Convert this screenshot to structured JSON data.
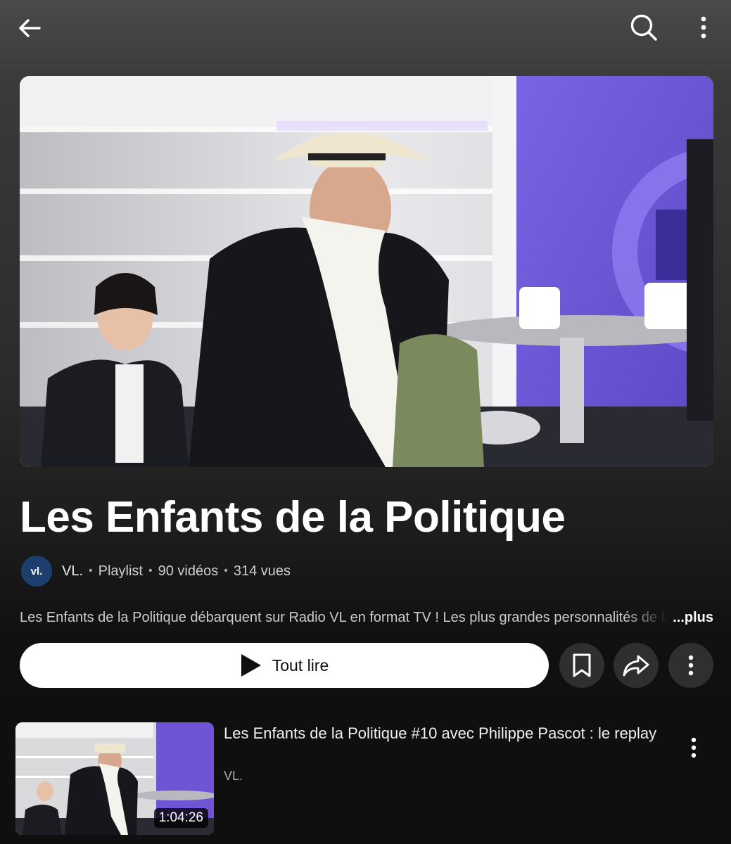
{
  "header": {
    "back_icon": "arrow-left-icon",
    "search_icon": "search-icon",
    "menu_icon": "more-vertical-icon"
  },
  "playlist": {
    "title": "Les Enfants de la Politique",
    "channel_avatar_text": "vl.",
    "channel": "VL.",
    "separator": "•",
    "type": "Playlist",
    "video_count": "90 vidéos",
    "views": "314 vues",
    "description": "Les Enfants de la Politique débarquent sur Radio VL en format TV ! Les plus grandes personnalités de la politique",
    "more_label": "...plus"
  },
  "actions": {
    "play_all_label": "Tout lire",
    "play_icon": "play-icon",
    "save_icon": "bookmark-icon",
    "share_icon": "share-icon",
    "more_icon": "more-vertical-icon"
  },
  "videos": [
    {
      "title": "Les Enfants de la Politique #10 avec Philippe Pascot : le replay",
      "channel": "VL.",
      "duration": "1:04:26"
    }
  ],
  "colors": {
    "background": "#0f0f0f",
    "button_bg": "#ffffff",
    "round_button_bg": "#2f2f2f",
    "avatar_bg": "#1d3f6d",
    "studio_purple": "#6f55d6"
  }
}
